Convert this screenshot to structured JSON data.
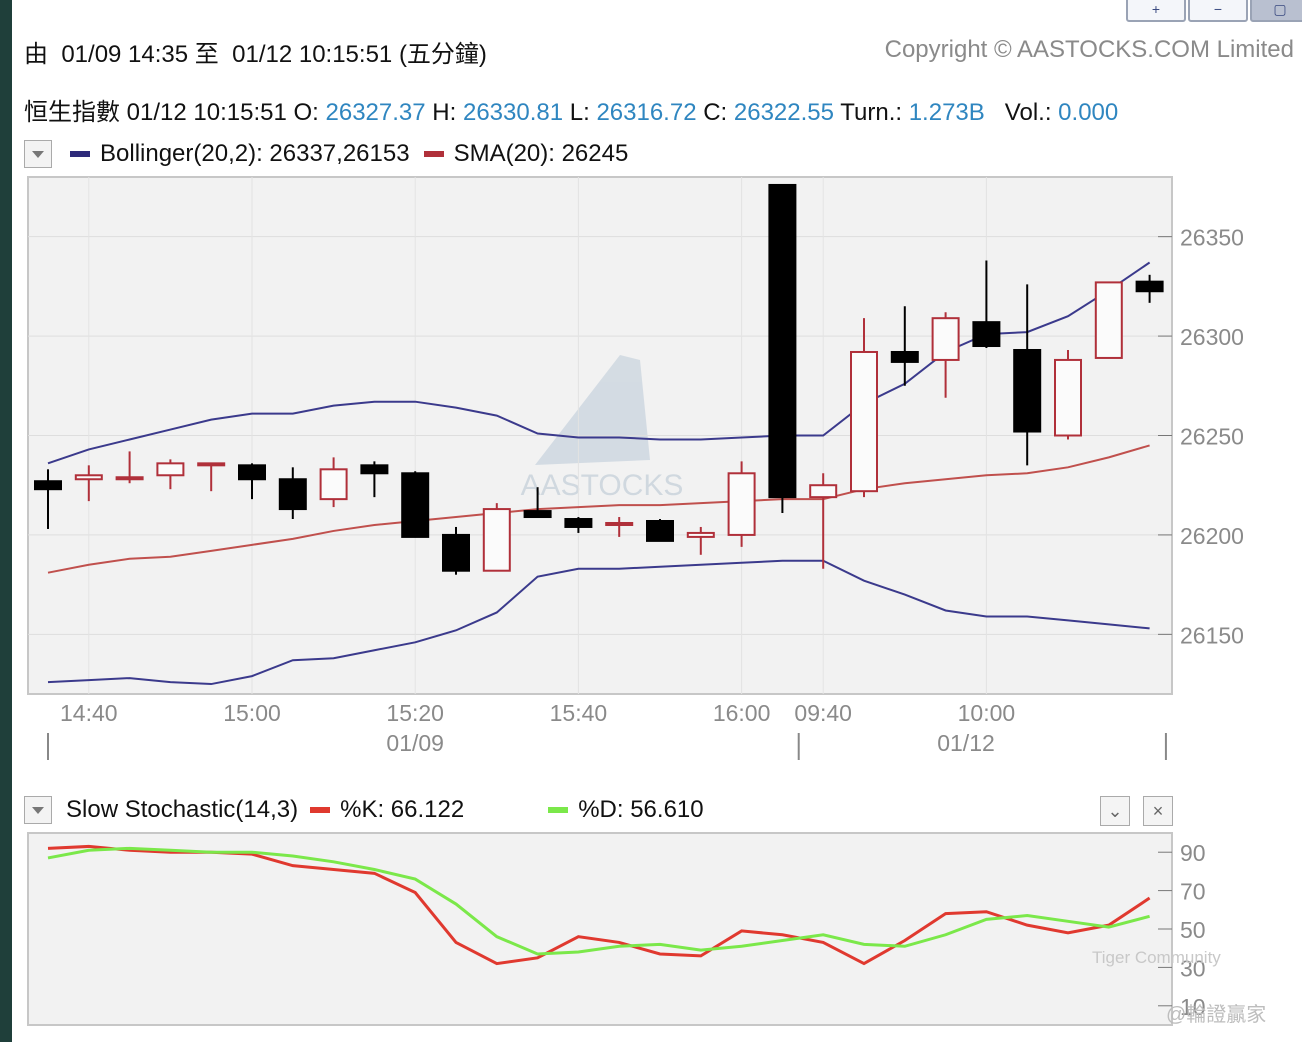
{
  "toolbar": {
    "zoom_in": "+",
    "zoom_out": "−",
    "settings": "▢"
  },
  "header": {
    "range": "由  01/09 14:35 至  01/12 10:15:51 (五分鐘)",
    "copyright": "Copyright © AASTOCKS.COM Limited"
  },
  "quote": {
    "name": "恒生指數",
    "time": "01/12 10:15:51",
    "o_label": "O:",
    "o": "26327.37",
    "h_label": "H:",
    "h": "26330.81",
    "l_label": "L:",
    "l": "26316.72",
    "c_label": "C:",
    "c": "26322.55",
    "turn_label": "Turn.:",
    "turn": "1.273B",
    "vol_label": "Vol.:",
    "vol": "0.000"
  },
  "legend_main": {
    "boll": "Bollinger(20,2): 26337,26153",
    "sma": "SMA(20): 26245"
  },
  "legend_stoch": {
    "title": "Slow Stochastic(14,3)",
    "k": "%K: 66.122",
    "d": "%D: 56.610"
  },
  "watermark": {
    "main": "AASTOCKS",
    "tiger": "Tiger Community",
    "author": "@輪證贏家"
  },
  "colors": {
    "bull": "#b0303a",
    "bear": "#000000",
    "boll": "#3b3a8c",
    "sma": "#c0504d",
    "k": "#e0392f",
    "d": "#7be84a",
    "axis": "#777777"
  },
  "chart_data": [
    {
      "type": "candlestick",
      "title": "恒生指數",
      "ylim": [
        26120,
        26380
      ],
      "yticks": [
        26150,
        26200,
        26250,
        26300,
        26350
      ],
      "x_tick_labels": [
        {
          "index": 1,
          "label": "14:40"
        },
        {
          "index": 5,
          "label": "15:00"
        },
        {
          "index": 9,
          "label": "15:20"
        },
        {
          "index": 13,
          "label": "15:40"
        },
        {
          "index": 17,
          "label": "16:00"
        },
        {
          "index": 19,
          "label": "09:40"
        },
        {
          "index": 23,
          "label": "10:00"
        }
      ],
      "date_labels": [
        {
          "index": 9,
          "label": "01/09"
        },
        {
          "index": 22.5,
          "label": "01/12"
        }
      ],
      "session_breaks": [
        0,
        18.4,
        27.4
      ],
      "ohlc": [
        [
          26227,
          26233,
          26203,
          26223
        ],
        [
          26228,
          26235,
          26217,
          26230
        ],
        [
          26229,
          26242,
          26226,
          26229
        ],
        [
          26230,
          26238,
          26223,
          26236
        ],
        [
          26236,
          26236,
          26222,
          26236
        ],
        [
          26235,
          26236,
          26218,
          26228
        ],
        [
          26228,
          26234,
          26208,
          26213
        ],
        [
          26218,
          26239,
          26214,
          26233
        ],
        [
          26235,
          26237,
          26219,
          26231
        ],
        [
          26231,
          26232,
          26199,
          26199
        ],
        [
          26200,
          26204,
          26180,
          26182
        ],
        [
          26182,
          26216,
          26182,
          26213
        ],
        [
          26212,
          26224,
          26209,
          26209
        ],
        [
          26208,
          26209,
          26201,
          26204
        ],
        [
          26205,
          26209,
          26199,
          26206
        ],
        [
          26207,
          26208,
          26197,
          26197
        ],
        [
          26199,
          26204,
          26190,
          26201
        ],
        [
          26200,
          26237,
          26194,
          26231
        ],
        [
          26376,
          26376,
          26211,
          26219
        ],
        [
          26219,
          26231,
          26183,
          26225
        ],
        [
          26222,
          26309,
          26219,
          26292
        ],
        [
          26292,
          26315,
          26275,
          26287
        ],
        [
          26288,
          26312,
          26269,
          26309
        ],
        [
          26307,
          26338,
          26294,
          26295
        ],
        [
          26293,
          26326,
          26235,
          26252
        ],
        [
          26250,
          26293,
          26248,
          26288
        ],
        [
          26289,
          26327,
          26289,
          26327
        ],
        [
          26327.37,
          26330.81,
          26316.72,
          26322.55
        ]
      ],
      "series": [
        {
          "name": "Bollinger upper",
          "values": [
            26236,
            26243,
            26248,
            26253,
            26258,
            26261,
            26261,
            26265,
            26267,
            26267,
            26264,
            26260,
            26251,
            26249,
            26249,
            26248,
            26248,
            26249,
            26250,
            26250,
            26266,
            26276,
            26292,
            26301,
            26302,
            26310,
            26323,
            26337
          ]
        },
        {
          "name": "SMA(20)",
          "values": [
            26181,
            26185,
            26188,
            26189,
            26192,
            26195,
            26198,
            26202,
            26205,
            26207,
            26209,
            26211,
            26213,
            26214,
            26215,
            26215,
            26216,
            26217,
            26218,
            26218,
            26223,
            26226,
            26228,
            26230,
            26231,
            26234,
            26239,
            26245
          ]
        },
        {
          "name": "Bollinger lower",
          "values": [
            26126,
            26127,
            26128,
            26126,
            26125,
            26129,
            26137,
            26138,
            26142,
            26146,
            26152,
            26161,
            26179,
            26183,
            26183,
            26184,
            26185,
            26186,
            26187,
            26187,
            26177,
            26170,
            26162,
            26159,
            26159,
            26157,
            26155,
            26153
          ]
        }
      ]
    },
    {
      "type": "line",
      "title": "Slow Stochastic(14,3)",
      "ylim": [
        0,
        100
      ],
      "yticks": [
        10,
        30,
        50,
        70,
        90
      ],
      "series": [
        {
          "name": "%K",
          "values": [
            92,
            93,
            91,
            90,
            90,
            89,
            83,
            81,
            79,
            69,
            43,
            32,
            35,
            46,
            43,
            37,
            36,
            49,
            47,
            43,
            32,
            44,
            58,
            59,
            52,
            48,
            52,
            66.122
          ]
        },
        {
          "name": "%D",
          "values": [
            87,
            91,
            92,
            91,
            90,
            90,
            88,
            85,
            81,
            76,
            63,
            46,
            37,
            38,
            41,
            42,
            39,
            41,
            44,
            47,
            42,
            41,
            47,
            55,
            57,
            54,
            51,
            56.61
          ]
        }
      ]
    }
  ]
}
